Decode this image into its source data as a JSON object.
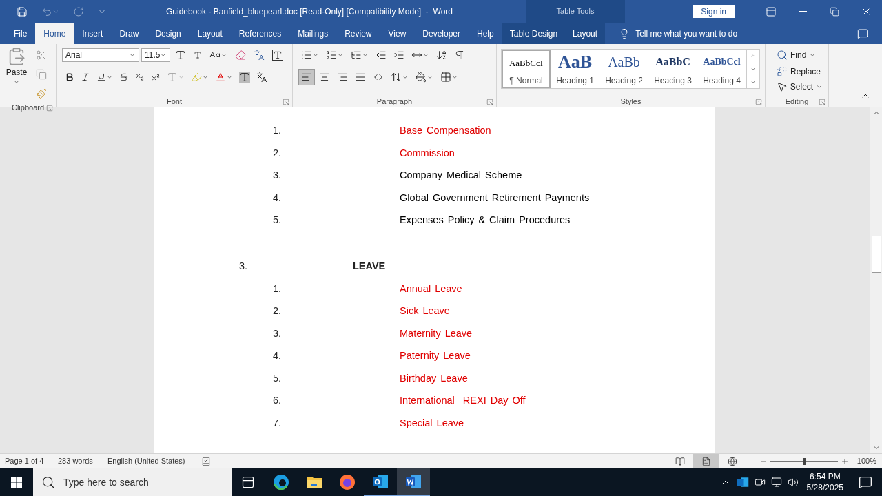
{
  "title_bar": {
    "title": "Guidebook - Banfield_bluepearl.doc [Read-Only] [Compatibility Mode]  -  Word",
    "context_label": "Table Tools",
    "sign_in": "Sign in"
  },
  "tabs": [
    {
      "label": "File",
      "selected": false
    },
    {
      "label": "Home",
      "selected": true
    },
    {
      "label": "Insert",
      "selected": false
    },
    {
      "label": "Draw",
      "selected": false
    },
    {
      "label": "Design",
      "selected": false
    },
    {
      "label": "Layout",
      "selected": false
    },
    {
      "label": "References",
      "selected": false
    },
    {
      "label": "Mailings",
      "selected": false
    },
    {
      "label": "Review",
      "selected": false
    },
    {
      "label": "View",
      "selected": false
    },
    {
      "label": "Developer",
      "selected": false
    },
    {
      "label": "Help",
      "selected": false
    }
  ],
  "context_tabs": [
    {
      "label": "Table Design",
      "selected": false
    },
    {
      "label": "Layout",
      "selected": false
    }
  ],
  "tell_me": "Tell me what you want to do",
  "ribbon": {
    "clipboard": {
      "paste": "Paste",
      "label": "Clipboard"
    },
    "font": {
      "name": "Arial",
      "size": "11.5",
      "label": "Font"
    },
    "paragraph": {
      "label": "Paragraph",
      "align_buttons": [
        {
          "kind": "left",
          "selected": true
        },
        {
          "kind": "center",
          "selected": false
        },
        {
          "kind": "right",
          "selected": false
        },
        {
          "kind": "justify",
          "selected": false
        }
      ]
    },
    "styles": {
      "label": "Styles",
      "items": [
        {
          "preview": "AaBbCcI",
          "name": "¶ Normal",
          "kind": "normal",
          "selected": true
        },
        {
          "preview": "AaB",
          "name": "Heading 1",
          "kind": "h1",
          "selected": false
        },
        {
          "preview": "AaBb",
          "name": "Heading 2",
          "kind": "h2",
          "selected": false
        },
        {
          "preview": "AaBbC",
          "name": "Heading 3",
          "kind": "h3",
          "selected": false
        },
        {
          "preview": "AaBbCcl",
          "name": "Heading 4",
          "kind": "h4",
          "selected": false
        }
      ]
    },
    "editing": {
      "label": "Editing",
      "find": "Find",
      "replace": "Replace",
      "select": "Select"
    }
  },
  "document": {
    "sections": [
      {
        "items": [
          {
            "number": "1.",
            "text": "Base Compensation",
            "color": "#e00000"
          },
          {
            "number": "2.",
            "text": "Commission",
            "color": "#e00000"
          },
          {
            "number": "3.",
            "text": "Company Medical Scheme",
            "color": "#000000"
          },
          {
            "number": "4.",
            "text": "Global Government Retirement Payments",
            "color": "#000000"
          },
          {
            "number": "5.",
            "text": "Expenses Policy & Claim Procedures",
            "color": "#000000"
          }
        ]
      },
      {
        "number": "3.",
        "heading": "LEAVE",
        "items": [
          {
            "number": "1.",
            "text": "Annual Leave",
            "color": "#e00000"
          },
          {
            "number": "2.",
            "text": "Sick Leave",
            "color": "#e00000"
          },
          {
            "number": "3.",
            "text": "Maternity Leave",
            "color": "#e00000"
          },
          {
            "number": "4.",
            "text": "Paternity Leave",
            "color": "#e00000"
          },
          {
            "number": "5.",
            "text": "Birthday Leave",
            "color": "#e00000"
          },
          {
            "number": "6.",
            "text": "International  REXI Day Off",
            "color": "#e00000"
          },
          {
            "number": "7.",
            "text": "Special Leave",
            "color": "#e00000"
          }
        ]
      }
    ]
  },
  "status_bar": {
    "page": "Page 1 of 4",
    "words": "283 words",
    "language": "English (United States)",
    "views": [
      {
        "kind": "read",
        "selected": false
      },
      {
        "kind": "print",
        "selected": true
      },
      {
        "kind": "web",
        "selected": false
      }
    ],
    "zoom_slider": {
      "level": 0.5
    },
    "zoom": "100%"
  },
  "taskbar": {
    "search_placeholder": "Type here to search",
    "time": "6:54 PM",
    "date": "5/28/2025"
  }
}
